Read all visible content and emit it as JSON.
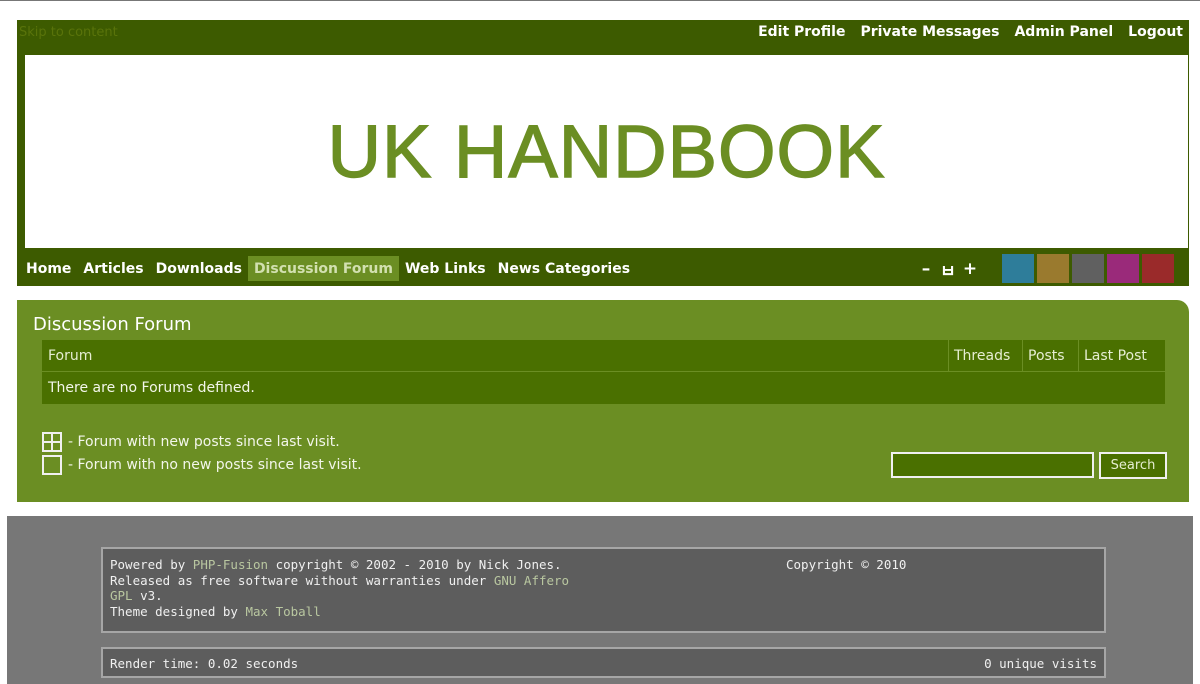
{
  "topbar": {
    "skip_link": "Skip to content",
    "user_links": [
      "Edit Profile",
      "Private Messages",
      "Admin Panel",
      "Logout"
    ]
  },
  "banner": {
    "logo_text": "UK HANDBOOK"
  },
  "nav": {
    "items": [
      "Home",
      "Articles",
      "Downloads",
      "Discussion Forum",
      "Web Links",
      "News Categories"
    ],
    "active": "Discussion Forum",
    "tools": {
      "decrease": "–",
      "reset": "ㅂ",
      "increase": "+"
    },
    "swatch_colors": [
      "#2e7d9a",
      "#9a7a2e",
      "#606060",
      "#9a2a7a",
      "#9a2a2a"
    ]
  },
  "forum": {
    "title": "Discussion Forum",
    "columns": [
      "Forum",
      "Threads",
      "Posts",
      "Last Post"
    ],
    "empty_message": "There are no Forums defined.",
    "legend": [
      {
        "icon": "new-posts-icon",
        "text": "- Forum with new posts since last visit."
      },
      {
        "icon": "no-new-posts-icon",
        "text": "- Forum with no new posts since last visit."
      }
    ],
    "search": {
      "value": "",
      "button": "Search"
    }
  },
  "footer": {
    "powered_prefix": "Powered by ",
    "powered_link": "PHP-Fusion",
    "powered_suffix": " copyright © 2002 - 2010 by Nick Jones.",
    "released_prefix": "Released as free software without warranties under ",
    "license_link": "GNU Affero GPL",
    "license_suffix": " v3.",
    "theme_prefix": "Theme designed by ",
    "theme_link": "Max Toball",
    "copyright": "Copyright © 2010",
    "render_time": "Render time: 0.02 seconds",
    "visits": "0 unique visits"
  },
  "colors": {
    "header_dark": "#3d5b00",
    "panel_green": "#6b8e23",
    "table_green": "#4a7000",
    "footer_gray": "#777777"
  }
}
